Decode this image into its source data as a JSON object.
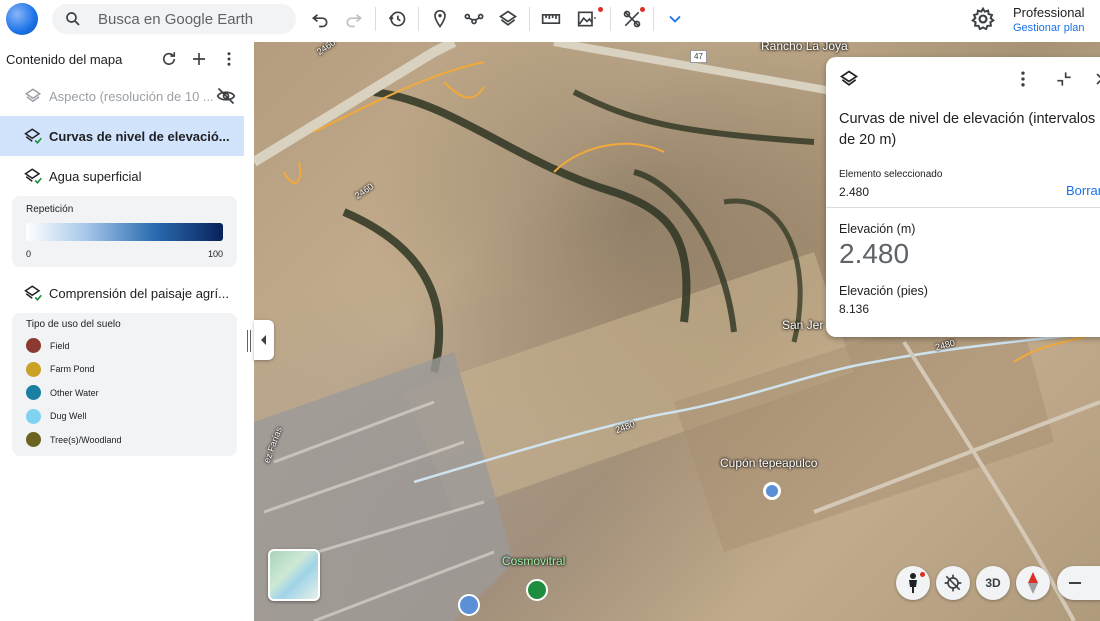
{
  "search": {
    "placeholder": "Busca en Google Earth"
  },
  "account": {
    "plan": "Professional",
    "manage": "Gestionar plan"
  },
  "sidebar": {
    "title": "Contenido del mapa",
    "layers": [
      {
        "label": "Aspecto (resolución de 10 ...",
        "state": "hidden"
      },
      {
        "label": "Curvas de nivel de elevació...",
        "state": "selected"
      },
      {
        "label": "Agua superficial",
        "state": "visible"
      },
      {
        "label": "Comprensión del paisaje agrí...",
        "state": "visible"
      }
    ],
    "repeat_legend": {
      "title": "Repetición",
      "min": "0",
      "max": "100"
    },
    "land_use_legend": {
      "title": "Tipo de uso del suelo",
      "items": [
        {
          "label": "Field",
          "color": "#8b3a32"
        },
        {
          "label": "Farm Pond",
          "color": "#c9a227"
        },
        {
          "label": "Other Water",
          "color": "#1a7fa0"
        },
        {
          "label": "Dug Well",
          "color": "#7fd3f0"
        },
        {
          "label": "Tree(s)/Woodland",
          "color": "#6b6420"
        }
      ]
    }
  },
  "map": {
    "labels": {
      "rancho": "Rancho La Joya",
      "sanjer": "San Jer",
      "cupon": "Cupón tepeapulco",
      "cosmo": "Cosmovitral",
      "road": "47",
      "c1": "2460",
      "c2": "2460",
      "c3": "2480",
      "c4": "2480",
      "street": "ez Farías"
    }
  },
  "panel": {
    "title": "Curvas de nivel de elevación (intervalos de 20 m)",
    "selected_label": "Elemento seleccionado",
    "selected_value": "2.480",
    "clear": "Borrar",
    "elev_m_label": "Elevación (m)",
    "elev_m_value": "2.480",
    "elev_ft_label": "Elevación (pies)",
    "elev_ft_value": "8.136"
  },
  "controls": {
    "three_d": "3D"
  }
}
